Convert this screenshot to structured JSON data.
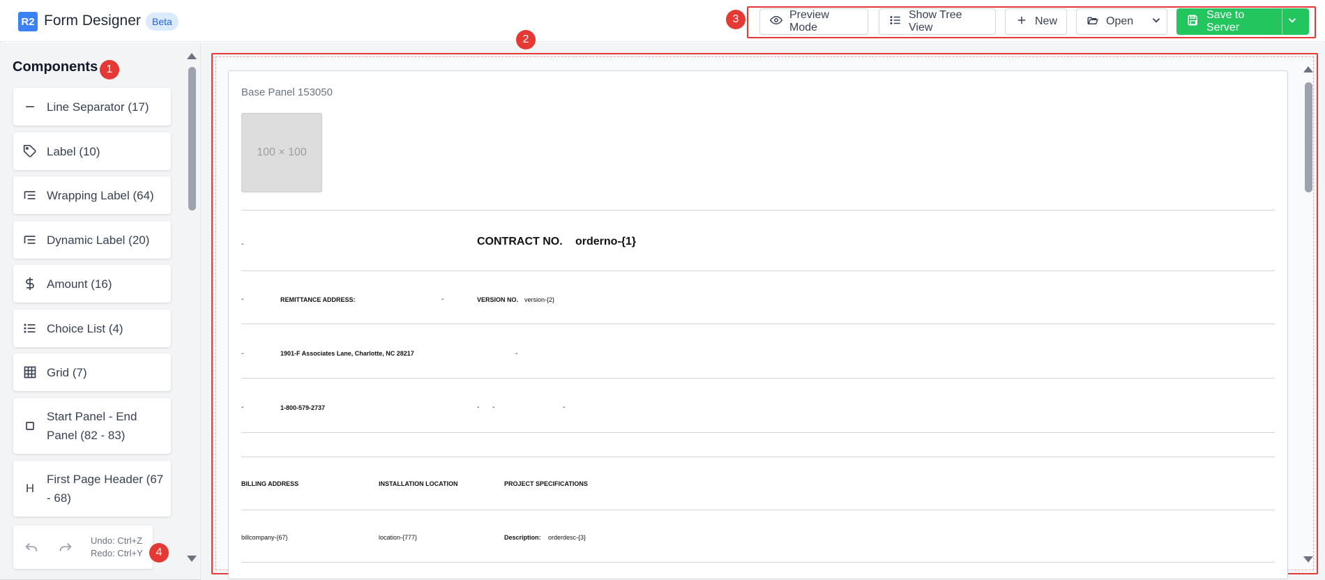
{
  "app": {
    "logo": "R2",
    "title": "Form Designer",
    "badge": "Beta"
  },
  "toolbar": {
    "preview": "Preview Mode",
    "tree": "Show Tree View",
    "new": "New",
    "open": "Open",
    "save": "Save to Server"
  },
  "annotations": [
    "1",
    "2",
    "3",
    "4"
  ],
  "sidebar": {
    "title": "Components",
    "items": [
      {
        "label": "Line Separator (17)",
        "icon": "minus-icon"
      },
      {
        "label": "Label (10)",
        "icon": "tag-icon"
      },
      {
        "label": "Wrapping Label (64)",
        "icon": "wrap-text-icon"
      },
      {
        "label": "Dynamic Label (20)",
        "icon": "wrap-text-icon"
      },
      {
        "label": "Amount (16)",
        "icon": "dollar-icon"
      },
      {
        "label": "Choice List (4)",
        "icon": "list-icon"
      },
      {
        "label": "Grid (7)",
        "icon": "grid-icon"
      },
      {
        "label": "Start Panel - End Panel (82 - 83)",
        "icon": "square-icon"
      },
      {
        "label": "First Page Header (67 - 68)",
        "icon": "heading-icon"
      }
    ],
    "undo": "Undo: Ctrl+Z",
    "redo": "Redo: Ctrl+Y"
  },
  "canvas": {
    "panel_title": "Base Panel 153050",
    "placeholder": "100 × 100",
    "contract_label": "CONTRACT NO.",
    "contract_value": "orderno-{1}",
    "remit_label": "REMITTANCE ADDRESS:",
    "version_label": "VERSION NO.",
    "version_value": "version-{2}",
    "address": "1901-F Associates Lane, Charlotte, NC 28217",
    "phone": "1-800-579-2737",
    "billing": "BILLING ADDRESS",
    "install": "INSTALLATION LOCATION",
    "specs": "PROJECT SPECIFICATIONS",
    "billcompany": "billcompany-{67}",
    "location": "location-{777}",
    "desc_label": "Description:",
    "desc_value": "orderdesc-{3}",
    "dash": "-"
  }
}
